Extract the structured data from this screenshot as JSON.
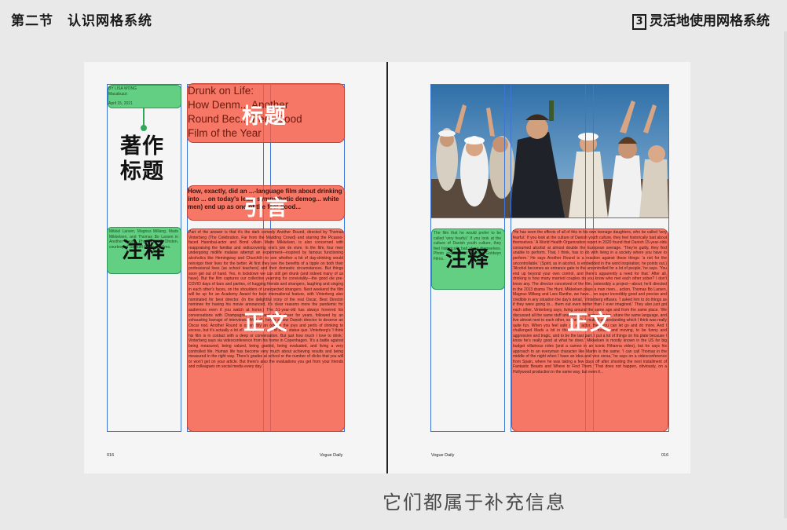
{
  "header": {
    "section": "第二节",
    "title": "认识网格系统",
    "right_num": "3",
    "right_title": "灵活地使用网格系统"
  },
  "left_page": {
    "meta_lines": [
      "BY LISA WONG",
      "Macabuzzi",
      "April 15, 2021"
    ],
    "author_label": [
      "著作",
      "标题"
    ],
    "title_en": [
      "Drunk on Life:",
      "How Denm... Another",
      "Round Bec... Feel-Good",
      "Film of the Year"
    ],
    "title_label": "标题",
    "quote_en": "How, exactly, did an ...-language film about drinking into ... on today's least sympathetic demog... white men) end up as one of the feel-good...",
    "quote_label": "引言",
    "note_label": "注释",
    "note_text": "Mikkel Larsen, Magnus Millang, Mads Mikkelsen, and Thomas Bo Larsen in Another Round. Photo: Henrik Ohsten, courtesy of Samuel Goldwyn Films.",
    "body_label": "正文",
    "body_text": "Part of the answer is that it's the dark comedy Another Round, directed by Thomas Vinterberg (The Celebration, Far from the Madding Crowd) and starring the Picasso-faced Hannibal-actor and Bond villain Mads Mikkelsen, is also concerned with reappraising the familiar and rediscovering one's joie de vivre. In the film, four men undergoing midlife malaise attempt an experiment—inspired by famous functioning alcoholics like Hemingway and Churchill—to see whether a bit of day-drinking would reinvigor their lives for the better. At first they see the benefits of a tipple on both their professional lives (as school teachers) and their domestic circumstances. But things soon get out of hand. Yes, in lockdown we can still get drunk (and indeed many of us have). But the film captures our collective yearning for conviviality—the good ole pre-COVID days of bars and parties, of hugging friends and strangers, laughing and singing in each other's faces, on the shoulders of unexpected strangers. Next weekend the film will be up for an Academy Award for best international feature, with Vinterberg also nominated for best director. (In the delightful irony of the real Oscar, Best Director nominee for having his movie announced, it's clear reasons more the pandemic for audiences even if you watch at home.) The 51-year-old has always hovered his conversations with Champagne, coffee, and good cheer for years, followed by an exhausting barrage of interviews. After all, here's a new Danish director to deserve an Oscar nod. Another Round is ostensibly an ode to the joys and perils of drinking to excess, but it's actually a lot of really just in one of one's statue quo. Vinterberg's 'I think his film is in contact with a deep or conversation. But just how much I love to drink,' Vinterberg says via videoconference from his home in Copenhagen. 'It's a battle against being measured, being valued, being graded, being evaluated, and living a very controlled life. Human life has become very much about achieving results and being measured in the right way. There's grades at school or the number of clicks that you will or won't get on your article. But there's also the evaluations you get from your friends and colleagues on social media every day.'",
    "footer_page": "016",
    "footer_mag": "Vogue Daily"
  },
  "right_page": {
    "note_label": "注释",
    "note_text": "The film that he would prefer to be called 'very fearful.' If you look at the culture of Danish youth culture, they feel historically bad about themselves. Photo courtesy of Samuel Goldwyn Films.",
    "body_label": "正文",
    "body_text": "'He has seen the effects of all of this in his own teenage daughters, who be called 'very fearful.' If you look at the culture of Danish youth culture, they feel historically bad about themselves.' A World Health Organization report in 2020 found that Danish 15-year-olds consumed alcohol at almost double the European average. 'They're guilty, they find unable to perform. That, I think, has to do with living in a society where you have to perform.' He says Another Round is a reaction against these things: 'a riot for the uncontrollable.' (Spirit, as in alcohol, is embedded in the word inspiration, he points out.) 'Alcohol becomes an entrance gate to the uncontrolled for a lot of people,' he says. 'You end up beyond your own control, and there's apparently a need for that.' After all, drinking is how many married couples do you know who met each other sober? I don't know any. The director conceived of the film, ostensibly a project—about; he'd directed in the 2013 drama The Hunt. Mikkelsen plays a man riven... action, Thomas Bo Larsen, Magnus Millang and Lars Ranthe, we have... on super incredibly good and precise and credible in any situation the day's detail,' Vinterberg effuses. 'I asked him to do things as if they were going to... them out even better than I ever imagined.' They also just got each other, Vinterberg says, living around the same age and from the same place. 'We discussed all the same stuff and watch the same movies, share the same language, and live almost next to each other, so there's a mutual understanding which I think was really quite fun. When you feel safe on an actor, then you can let go and do more. And I challenged Mads a bit in this movie—to be foolish and moving, to be funny and aggressive and tragic, and to be the last part. I put a lot of things on his plate because I know he's really good at what he does.' Mikkelsen is mostly known in the US for big budget villainous roles (and a cameo in an iconic Rihanna video), but he says his approach to an everyman character like Martin is the same. 'I can call Thomas in the middle of the night when I have an idea and vice versa,' he says on a videoconference from Spain, where he was taking a few days off after shooting the next installment of Fantastic Beasts and Where to Find Them. 'That does not happen, obviously, on a Hollywood production in the same way, but even if...",
    "footer_page": "016",
    "footer_mag": "Vogue Daily"
  },
  "subtitle": "它们都属于补充信息",
  "colors": {
    "red": "#f65c46",
    "green": "#48c86e",
    "grid": "#3b76d6"
  }
}
